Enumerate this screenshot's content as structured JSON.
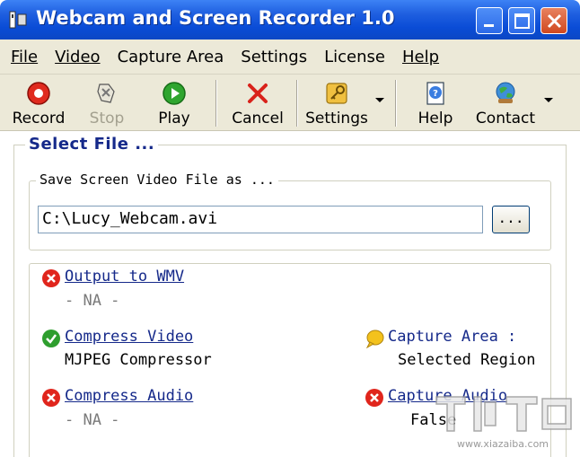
{
  "window": {
    "title": "Webcam and Screen Recorder 1.0"
  },
  "menu": [
    "File",
    "Video",
    "Capture Area",
    "Settings",
    "License",
    "Help"
  ],
  "toolbar": {
    "record": "Record",
    "stop": "Stop",
    "play": "Play",
    "cancel": "Cancel",
    "settings": "Settings",
    "help": "Help",
    "contact": "Contact"
  },
  "select_file": {
    "title": "Select File ...",
    "save_group_title": "Save Screen Video File as ...",
    "path_value": "C:\\Lucy_Webcam.avi",
    "browse_label": "..."
  },
  "options": {
    "output_wmv": {
      "label": "Output to WMV",
      "value": "- NA -",
      "status": "off"
    },
    "compress_video": {
      "label": "Compress Video",
      "value": "MJPEG Compressor",
      "status": "on"
    },
    "compress_audio": {
      "label": "Compress Audio",
      "value": "- NA -",
      "status": "off"
    },
    "capture_area": {
      "label": "Capture Area :",
      "value": "Selected Region",
      "status": "info"
    },
    "capture_audio": {
      "label": "Capture Audio",
      "value": "False",
      "status": "off"
    }
  },
  "watermark": {
    "text": "下载吧",
    "url": "www.xiazaiba.com"
  },
  "colors": {
    "titlebar": "#0a4cd6",
    "chrome": "#ece9d8",
    "link": "#15298a",
    "error": "#e0251c",
    "success": "#2e9e2e"
  }
}
